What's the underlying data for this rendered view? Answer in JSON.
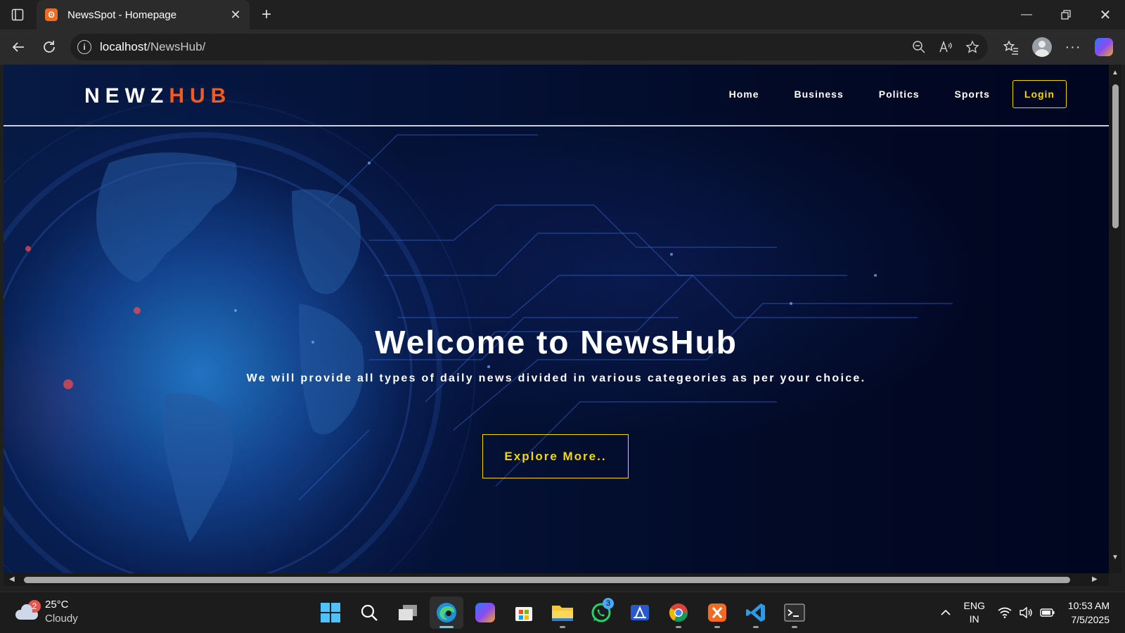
{
  "browser": {
    "tab_title": "NewsSpot - Homepage",
    "favicon_glyph": "ʘ",
    "url_host": "localhost",
    "url_path": "/NewsHub/",
    "info_glyph": "i"
  },
  "site": {
    "logo_main": "NEWZ",
    "logo_accent": "HUB",
    "nav": [
      {
        "label": "Home"
      },
      {
        "label": "Business"
      },
      {
        "label": "Politics"
      },
      {
        "label": "Sports"
      }
    ],
    "login_label": "Login",
    "hero_title": "Welcome to NewsHub",
    "hero_subtitle": "We will provide all types of daily news divided in various categeories as per your choice.",
    "cta_label": "Explore More..",
    "colors": {
      "accent_orange": "#f25b1f",
      "accent_yellow": "#f5d800"
    }
  },
  "taskbar": {
    "weather_badge": "2",
    "temperature": "25°C",
    "condition": "Cloudy",
    "whatsapp_badge": "3",
    "lang_1": "ENG",
    "lang_2": "IN",
    "time": "10:53 AM",
    "date": "7/5/2025"
  }
}
